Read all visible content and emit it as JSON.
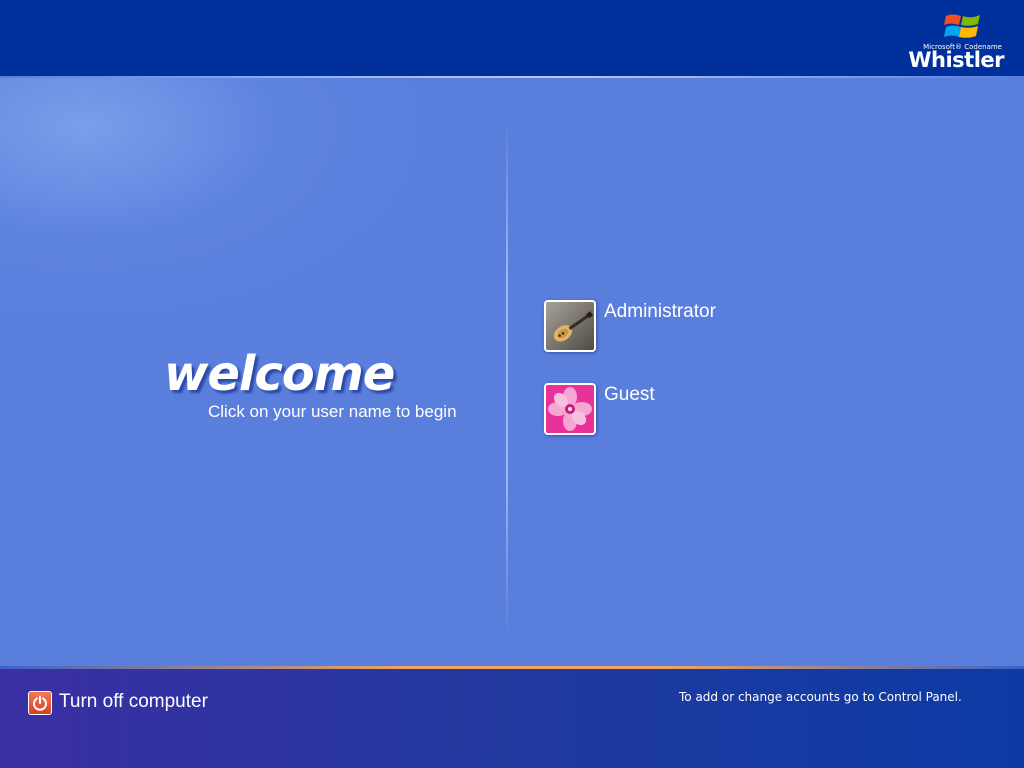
{
  "branding": {
    "small_text": "Microsoft® Codename",
    "product_name": "Whistler",
    "logo_icon": "windows-flag-icon"
  },
  "welcome": {
    "heading": "welcome",
    "instruction": "Click on your user name to begin"
  },
  "users": [
    {
      "name": "Administrator",
      "picture_icon": "guitar-picture"
    },
    {
      "name": "Guest",
      "picture_icon": "flower-picture"
    }
  ],
  "footer": {
    "turn_off_label": "Turn off computer",
    "turn_off_icon": "power-icon",
    "help_text": "To add or change accounts go to Control Panel."
  },
  "colors": {
    "background": "#5a7edc",
    "top_bar": "#00309c",
    "accent_line": "#f3a45a",
    "power_button": "#d9401e"
  }
}
